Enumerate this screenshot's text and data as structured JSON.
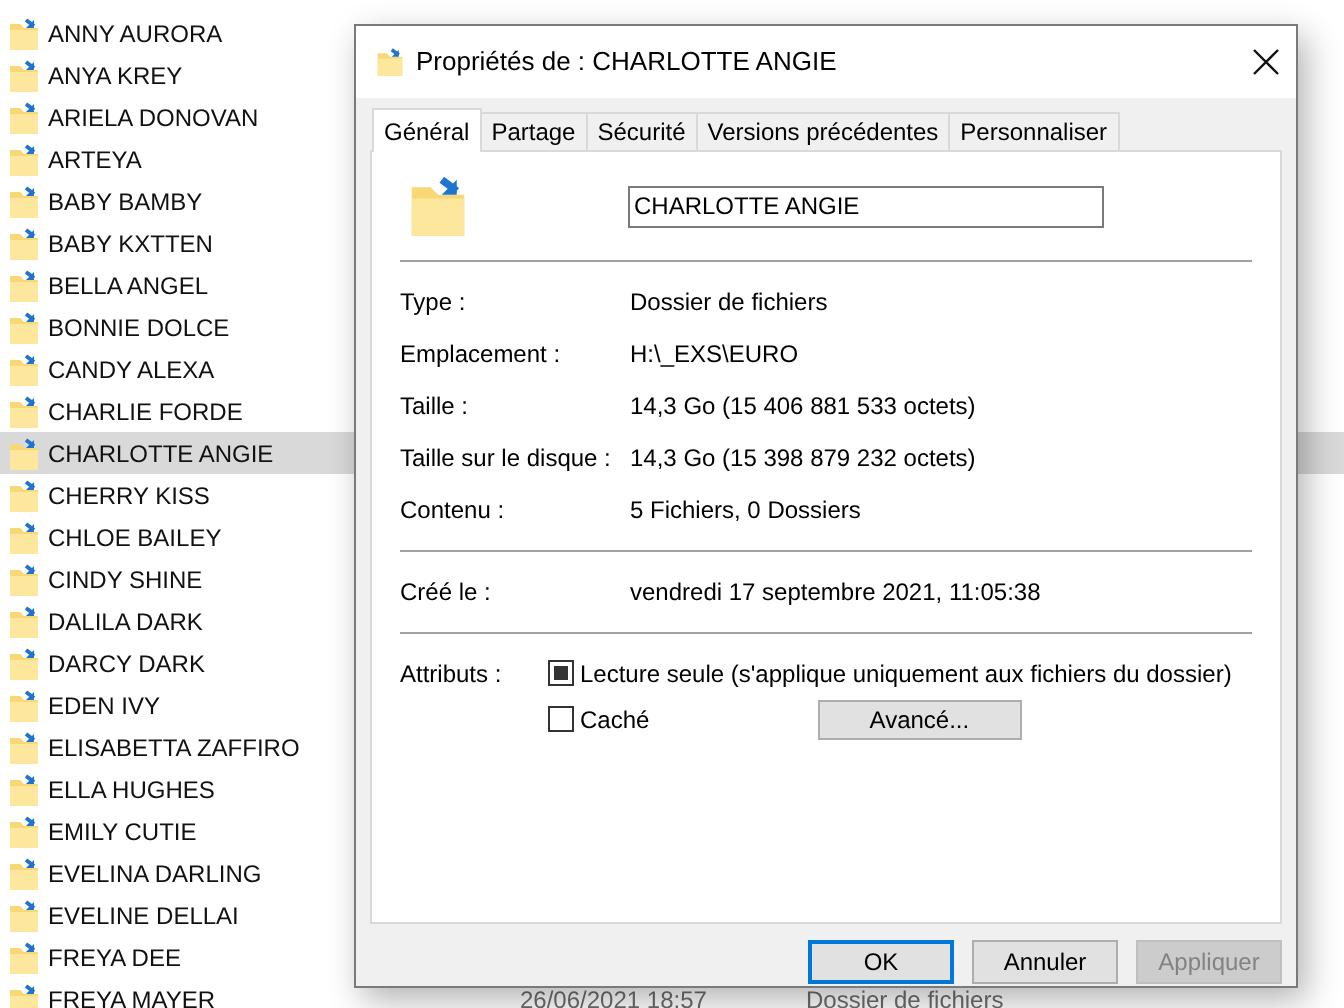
{
  "folders": [
    {
      "name": "ANNY AURORA",
      "selected": false
    },
    {
      "name": "ANYA KREY",
      "selected": false
    },
    {
      "name": "ARIELA DONOVAN",
      "selected": false
    },
    {
      "name": "ARTEYA",
      "selected": false
    },
    {
      "name": "BABY BAMBY",
      "selected": false
    },
    {
      "name": "BABY KXTTEN",
      "selected": false
    },
    {
      "name": "BELLA ANGEL",
      "selected": false
    },
    {
      "name": "BONNIE DOLCE",
      "selected": false
    },
    {
      "name": "CANDY ALEXA",
      "selected": false
    },
    {
      "name": "CHARLIE FORDE",
      "selected": false
    },
    {
      "name": "CHARLOTTE ANGIE",
      "selected": true
    },
    {
      "name": "CHERRY KISS",
      "selected": false
    },
    {
      "name": "CHLOE BAILEY",
      "selected": false
    },
    {
      "name": "CINDY SHINE",
      "selected": false
    },
    {
      "name": "DALILA DARK",
      "selected": false
    },
    {
      "name": "DARCY DARK",
      "selected": false
    },
    {
      "name": "EDEN IVY",
      "selected": false
    },
    {
      "name": "ELISABETTA ZAFFIRO",
      "selected": false
    },
    {
      "name": "ELLA HUGHES",
      "selected": false
    },
    {
      "name": "EMILY CUTIE",
      "selected": false
    },
    {
      "name": "EVELINA DARLING",
      "selected": false
    },
    {
      "name": "EVELINE DELLAI",
      "selected": false
    },
    {
      "name": "FREYA DEE",
      "selected": false
    },
    {
      "name": "FREYA MAYER",
      "selected": false,
      "date": "26/06/2021 18:57",
      "type": "Dossier de fichiers"
    }
  ],
  "dialog": {
    "title": "Propriétés de : CHARLOTTE ANGIE",
    "tabs": [
      {
        "label": "Général",
        "selected": true
      },
      {
        "label": "Partage",
        "selected": false
      },
      {
        "label": "Sécurité",
        "selected": false
      },
      {
        "label": "Versions précédentes",
        "selected": false
      },
      {
        "label": "Personnaliser",
        "selected": false
      }
    ],
    "name_field": "CHARLOTTE ANGIE",
    "groups": [
      [
        {
          "label": "Type :",
          "value": "Dossier de fichiers"
        },
        {
          "label": "Emplacement :",
          "value": "H:\\_EXS\\EURO"
        },
        {
          "label": "Taille :",
          "value": "14,3 Go (15 406 881 533 octets)"
        },
        {
          "label": "Taille sur le disque :",
          "value": "14,3 Go (15 398 879 232 octets)"
        },
        {
          "label": "Contenu :",
          "value": "5 Fichiers, 0 Dossiers"
        }
      ],
      [
        {
          "label": "Créé le :",
          "value": "vendredi 17 septembre 2021, 11:05:38"
        }
      ]
    ],
    "attributes_label": "Attributs :",
    "attributes": [
      {
        "label": "Lecture seule (s'applique uniquement aux fichiers du dossier)",
        "checked": true
      },
      {
        "label": "Caché",
        "checked": false
      }
    ],
    "advanced_button": "Avancé...",
    "buttons": [
      {
        "label": "OK",
        "kind": "default"
      },
      {
        "label": "Annuler",
        "kind": "normal"
      },
      {
        "label": "Appliquer",
        "kind": "disabled"
      }
    ]
  }
}
